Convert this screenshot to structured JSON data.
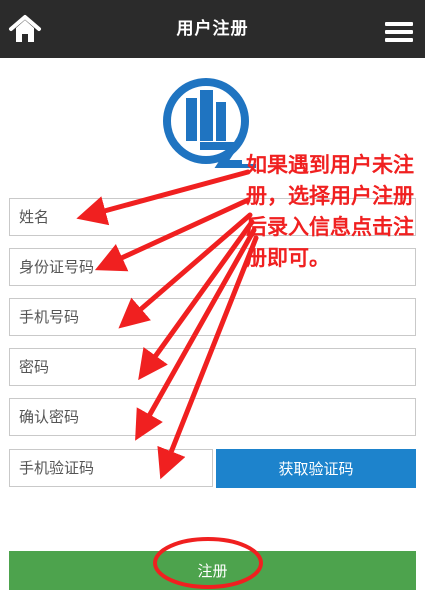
{
  "header": {
    "title": "用户注册",
    "left_icon": "home-icon",
    "right_icon": "menu-icon"
  },
  "logo": {
    "icon": "building-logo-icon"
  },
  "form": {
    "name_placeholder": "姓名",
    "id_placeholder": "身份证号码",
    "phone_placeholder": "手机号码",
    "password_placeholder": "密码",
    "confirm_placeholder": "确认密码",
    "code_placeholder": "手机验证码",
    "get_code_label": "获取验证码",
    "submit_label": "注册"
  },
  "annotation": {
    "text": "如果遇到用户未注册，选择用户注册后录入信息点击注册即可。"
  },
  "colors": {
    "header_bg": "#2b2b2b",
    "code_button": "#1d83cc",
    "submit_button": "#4da34d",
    "annotation": "#f02020",
    "logo_blue": "#1f74c1"
  }
}
